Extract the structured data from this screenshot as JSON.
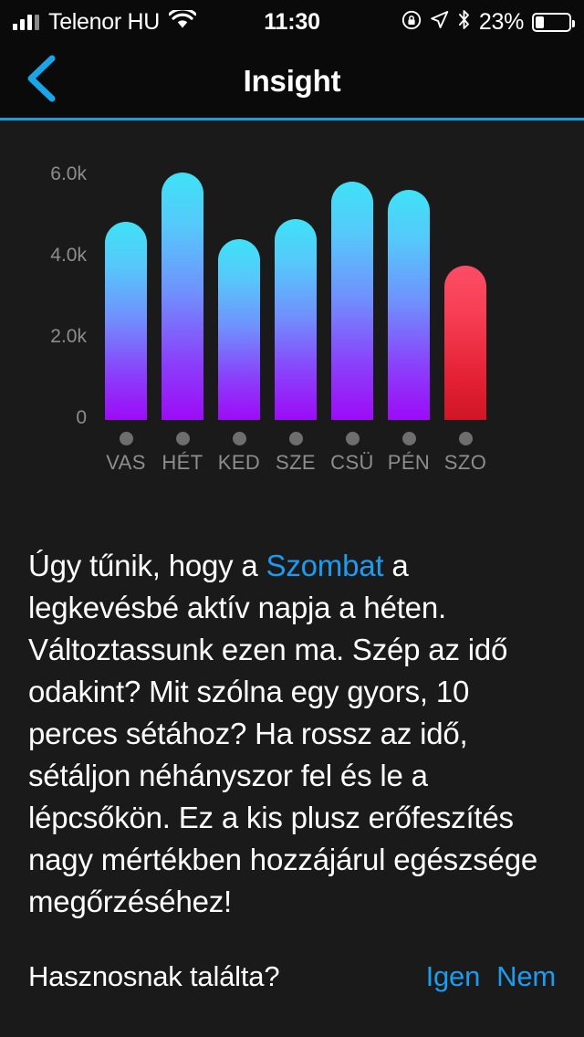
{
  "statusbar": {
    "carrier": "Telenor HU",
    "time": "11:30",
    "battery_percent": "23%",
    "battery_level": 23,
    "icons": [
      "signal-bars-icon",
      "wifi-icon",
      "rotation-lock-icon",
      "location-arrow-icon",
      "bluetooth-icon",
      "battery-icon"
    ]
  },
  "navbar": {
    "title": "Insight",
    "back_icon": "chevron-left-icon",
    "accent_color": "#0e9fe0"
  },
  "chart_data": {
    "type": "bar",
    "title": "",
    "xlabel": "",
    "ylabel": "",
    "categories": [
      "VAS",
      "HÉT",
      "KED",
      "SZE",
      "CSÜ",
      "PÉN",
      "SZO"
    ],
    "values": [
      4880,
      6090,
      4450,
      4940,
      5870,
      5660,
      3800
    ],
    "ytick_labels": [
      "6.0k",
      "4.0k",
      "2.0k",
      "0"
    ],
    "ytick_values": [
      6000,
      4000,
      2000,
      0
    ],
    "ylim": [
      0,
      6700
    ],
    "grid": false,
    "legend": "none",
    "highlight_index": 6,
    "bar_color_top": "#3fe2f7",
    "bar_color_bottom": "#9d0bf7",
    "highlight_color_top": "#fb4d66",
    "highlight_color_bottom": "#cf1626",
    "dot_color": "#6e6e6e"
  },
  "insight": {
    "lead": "Úgy tűnik, hogy a ",
    "highlight_day": "Szombat",
    "rest": " a legkevésbé aktív napja a héten. Változtassunk ezen ma. Szép az idő odakint? Mit szólna egy gyors, 10 perces sétához? Ha rossz az idő, sétáljon néhányszor fel és le a lépcsőkön. Ez a kis plusz erőfeszítés nagy mértékben hozzájárul egészsége megőrzéséhez!"
  },
  "feedback": {
    "question": "Hasznosnak találta?",
    "yes_label": "Igen",
    "no_label": "Nem"
  }
}
